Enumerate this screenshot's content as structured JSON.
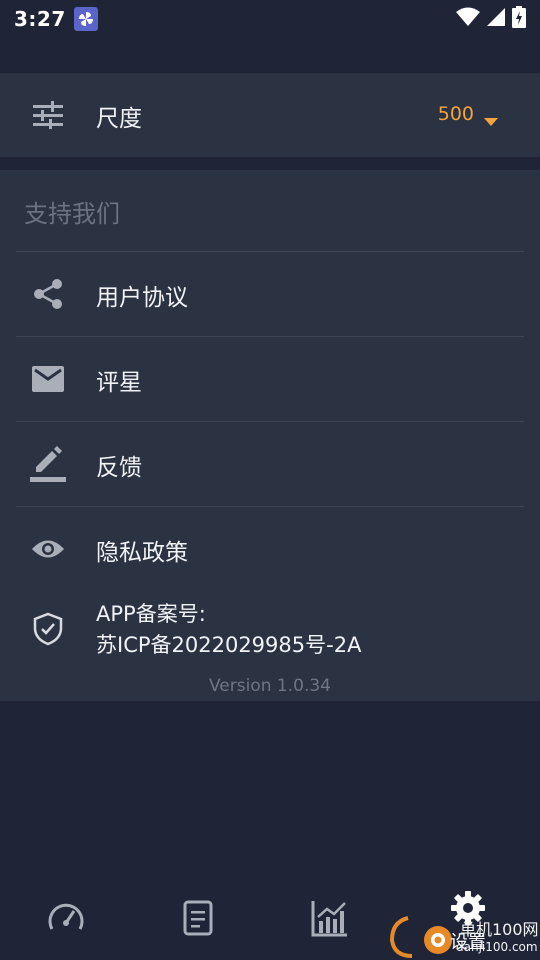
{
  "status_bar": {
    "time": "3:27",
    "app_icon": "pinwheel-icon",
    "icons": [
      "wifi-icon",
      "signal-icon",
      "battery-charging-icon"
    ]
  },
  "scale": {
    "label": "尺度",
    "value": "500",
    "icon": "tune-sliders-icon"
  },
  "support": {
    "title": "支持我们",
    "items": [
      {
        "label": "用户协议",
        "icon": "share-icon"
      },
      {
        "label": "评星",
        "icon": "mail-icon"
      },
      {
        "label": "反馈",
        "icon": "edit-icon"
      },
      {
        "label": "隐私政策",
        "icon": "eye-icon"
      }
    ],
    "record_line1": "APP备案号:",
    "record_line2": "苏ICP备2022029985号-2A",
    "record_icon": "shield-check-icon",
    "version": "Version 1.0.34"
  },
  "bottom_nav": {
    "items": [
      {
        "icon": "speedometer-icon"
      },
      {
        "icon": "document-icon"
      },
      {
        "icon": "chart-icon"
      },
      {
        "icon": "gear-icon",
        "label": "设置",
        "active": true
      }
    ]
  },
  "watermark": {
    "text1": "单机100网",
    "text2": "danji100.com"
  },
  "colors": {
    "background": "#1f2437",
    "card": "#2b3242",
    "accent": "#f4a43b",
    "muted": "#6b7283"
  }
}
